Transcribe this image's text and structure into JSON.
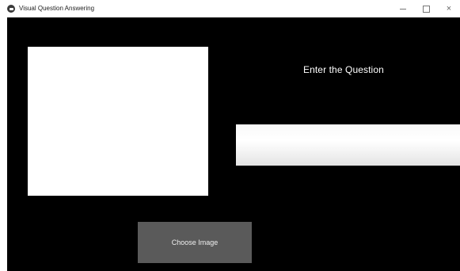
{
  "window": {
    "title": "Visual Question Answering",
    "controls": {
      "minimize_icon": "minimize-icon",
      "maximize_icon": "maximize-icon",
      "close_icon": "close-icon",
      "close_glyph": "×"
    }
  },
  "main": {
    "question_label": "Enter the Question",
    "question_input_value": "",
    "choose_image_label": "Choose Image"
  },
  "colors": {
    "client_background": "#000000",
    "image_panel": "#ffffff",
    "button_background": "#5a5a5a",
    "label_text": "#ffffff"
  }
}
